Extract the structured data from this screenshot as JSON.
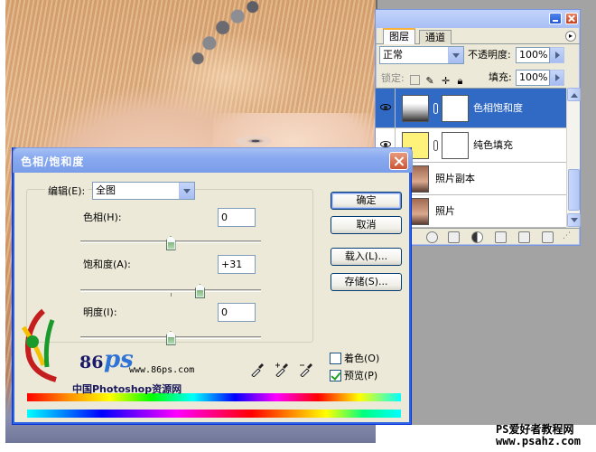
{
  "layers_panel": {
    "tabs": [
      {
        "label": "图层"
      },
      {
        "label": "通道"
      }
    ],
    "blend_mode": "正常",
    "opacity_label": "不透明度:",
    "opacity_value": "100%",
    "lock_label": "锁定:",
    "fill_label": "填充:",
    "fill_value": "100%",
    "layers": [
      {
        "name": "色相饱和度",
        "selected": true
      },
      {
        "name": "纯色填充",
        "selected": false
      },
      {
        "name": "照片副本",
        "selected": false
      },
      {
        "name": "照片",
        "selected": false
      }
    ]
  },
  "dialog": {
    "title": "色相/饱和度",
    "edit_label": "编辑(E):",
    "edit_value": "全图",
    "hue_label": "色相(H):",
    "hue_value": "0",
    "saturation_label": "饱和度(A):",
    "saturation_value": "+31",
    "lightness_label": "明度(I):",
    "lightness_value": "0",
    "ok_button": "确定",
    "cancel_button": "取消",
    "load_button": "载入(L)...",
    "save_button": "存储(S)...",
    "colorize_label": "着色(O)",
    "colorize_checked": false,
    "preview_label": "预览(P)",
    "preview_checked": true,
    "slider_levels": {
      "hue": 0,
      "saturation": 31,
      "lightness": 0
    }
  },
  "watermark": {
    "brand_number": "86",
    "brand_ps": "ps",
    "url": "www.86ps.com",
    "cn_name": "中国Photoshop资源网"
  },
  "footer": {
    "line1": "PS爱好者教程网",
    "line2": "www.psahz.com"
  },
  "colors": {
    "xp_blue": "#316ac5",
    "dialog_bg": "#ece9d8",
    "fill_thumb": "#fff27a"
  }
}
